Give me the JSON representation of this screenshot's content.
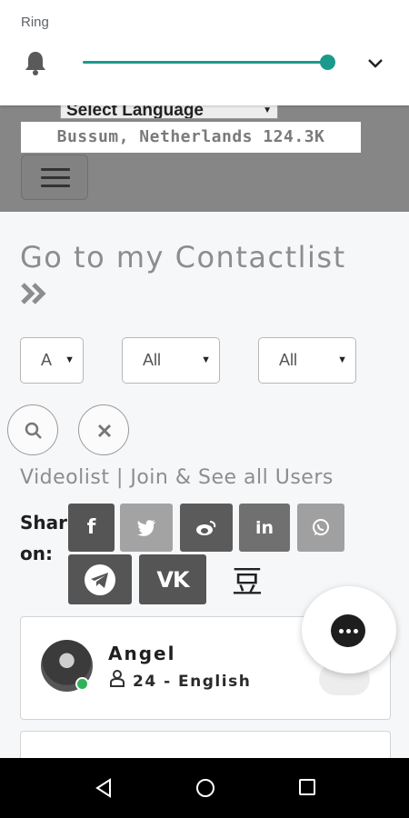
{
  "volume": {
    "label": "Ring",
    "level_percent": 100,
    "accent_color": "#1a9a8c",
    "icons": [
      "bell-icon",
      "chevron-down-icon"
    ]
  },
  "header": {
    "language_select": "Select Language",
    "location": "Bussum, Netherlands 124.3K",
    "menu_icon": "hamburger-icon"
  },
  "main": {
    "contactlist_title": "Go to my Contactlist",
    "filters": [
      {
        "value": "A"
      },
      {
        "value": "All"
      },
      {
        "value": "All"
      }
    ],
    "videolist_link": "Videolist | Join & See all Users",
    "share_label": "Share on:",
    "share_buttons": [
      {
        "name": "facebook",
        "glyph": "f"
      },
      {
        "name": "twitter",
        "glyph": ""
      },
      {
        "name": "weibo",
        "glyph": ""
      },
      {
        "name": "linkedin",
        "glyph": "in"
      },
      {
        "name": "whatsapp",
        "glyph": ""
      },
      {
        "name": "telegram",
        "glyph": ""
      },
      {
        "name": "vk",
        "glyph": "VK"
      },
      {
        "name": "douban",
        "glyph": "豆"
      }
    ]
  },
  "users": [
    {
      "name": "Angel",
      "age_language": "24 - English",
      "status_color": "#2fb35a"
    }
  ]
}
